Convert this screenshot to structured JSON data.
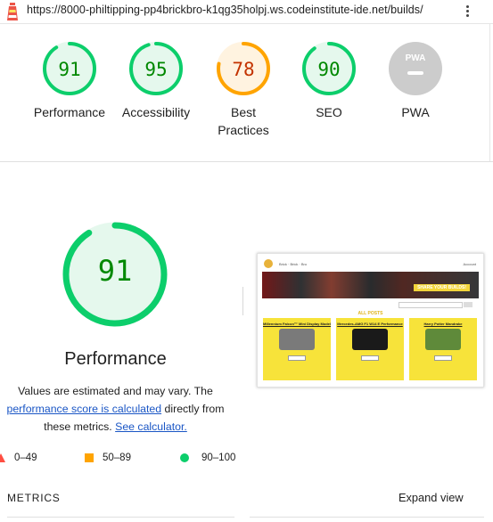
{
  "url": "https://8000-philtipping-pp4brickbro-k1qg35holpj.ws.codeinstitute-ide.net/builds/",
  "colors": {
    "pass": "#0cce6b",
    "pass_text": "#008800",
    "pass_fill": "#e5f8ed",
    "average": "#ffa400",
    "average_text": "#c33300",
    "average_fill": "#fff3e0",
    "na": "#cccccc"
  },
  "categories": [
    {
      "label": "Performance",
      "score": "91",
      "score_value": 0.91,
      "rating": "pass"
    },
    {
      "label": "Accessibility",
      "score": "95",
      "score_value": 0.95,
      "rating": "pass"
    },
    {
      "label": "Best Practices",
      "score": "78",
      "score_value": 0.78,
      "rating": "average"
    },
    {
      "label": "SEO",
      "score": "90",
      "score_value": 0.9,
      "rating": "pass"
    },
    {
      "label": "PWA",
      "score": "",
      "rating": "na",
      "badge": "PWA"
    }
  ],
  "performance": {
    "score": "91",
    "title": "Performance",
    "desc_1": "Values are estimated and may vary. The",
    "desc_link": "performance score is calculated",
    "desc_2": "directly from",
    "desc_3": "these metrics.",
    "calc_link": "See calculator."
  },
  "legend": {
    "fail": "0–49",
    "average": "50–89",
    "pass": "90–100"
  },
  "preview": {
    "nav": "Brick · Brick · Bro",
    "user": "Account",
    "hero_text": "SHARE YOUR BUILDS!",
    "section_title": "ALL POSTS",
    "cards": [
      {
        "title": "Millennium Falcon™ Mini Display Model",
        "img_color": "#7a7a7a"
      },
      {
        "title": "Mercedes-AMG F1 W14 E Performance",
        "img_color": "#1a1a1a"
      },
      {
        "title": "Harry Potter Mandrake",
        "img_color": "#5f8a3a"
      }
    ]
  },
  "metrics_heading": "METRICS",
  "expand_label": "Expand view"
}
